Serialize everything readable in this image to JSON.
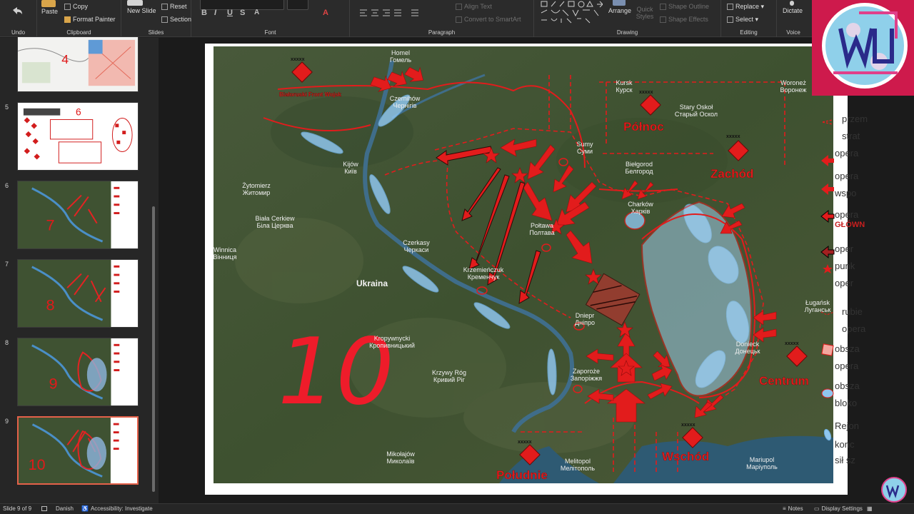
{
  "ribbon": {
    "undo": {
      "label": "Undo"
    },
    "clipboard": {
      "label": "Clipboard",
      "paste": "Paste",
      "copy": "Copy",
      "format_painter": "Format Painter"
    },
    "slides": {
      "label": "Slides",
      "new_slide": "New Slide",
      "reset": "Reset",
      "section": "Section"
    },
    "font": {
      "label": "Font",
      "bold": "B",
      "italic": "I",
      "underline": "U",
      "strike": "S",
      "aa": "A"
    },
    "paragraph": {
      "label": "Paragraph",
      "align_text": "Align Text",
      "convert_smartart": "Convert to SmartArt"
    },
    "drawing": {
      "label": "Drawing",
      "arrange": "Arrange",
      "quick_styles": "Quick Styles",
      "shape_outline": "Shape Outline",
      "shape_effects": "Shape Effects"
    },
    "editing": {
      "label": "Editing",
      "replace": "Replace",
      "select": "Select"
    },
    "voice": {
      "label": "Voice",
      "dictate": "Dictate"
    }
  },
  "thumbnails": [
    {
      "number": "",
      "label": "4"
    },
    {
      "number": "5",
      "label": "6"
    },
    {
      "number": "6",
      "label": "7"
    },
    {
      "number": "7",
      "label": "8"
    },
    {
      "number": "8",
      "label": "9"
    },
    {
      "number": "9",
      "label": "10"
    }
  ],
  "map": {
    "handwritten": "10",
    "country": "Ukraina",
    "fronts": {
      "north": "Północ",
      "west": "Zachód",
      "center": "Centrum",
      "east": "Wschód",
      "south": "Południe",
      "belarus": "Białoruski Front Wojsk"
    },
    "unit_mark": "xxxxx",
    "cities": [
      {
        "pl": "Homel",
        "local": "Гомель"
      },
      {
        "pl": "Kursk",
        "local": "Курск"
      },
      {
        "pl": "Woroneż",
        "local": "Воронеж"
      },
      {
        "pl": "Stary Oskoł",
        "local": "Старый Оскол"
      },
      {
        "pl": "Czernihów",
        "local": "Чернігів"
      },
      {
        "pl": "Sumy",
        "local": "Суми"
      },
      {
        "pl": "Biełgorod",
        "local": "Белгород"
      },
      {
        "pl": "Żytomierz",
        "local": "Житомир"
      },
      {
        "pl": "Kijów",
        "local": "Київ"
      },
      {
        "pl": "Charków",
        "local": "Харків"
      },
      {
        "pl": "Biała Cerkiew",
        "local": "Біла Церква"
      },
      {
        "pl": "Połtawa",
        "local": "Полтава"
      },
      {
        "pl": "Winnica",
        "local": "Вінниця"
      },
      {
        "pl": "Czerkasy",
        "local": "Черкаси"
      },
      {
        "pl": "Krzemieńczuk",
        "local": "Кременчук"
      },
      {
        "pl": "Ługańsk",
        "local": "Луганськ"
      },
      {
        "pl": "Dniepr",
        "local": "Дніпро"
      },
      {
        "pl": "Kropywnycki",
        "local": "Кропивницький"
      },
      {
        "pl": "Donieck",
        "local": "Донецьк"
      },
      {
        "pl": "Zaporoże",
        "local": "Запоріжжя"
      },
      {
        "pl": "Krzywy Róg",
        "local": "Кривий Ріг"
      },
      {
        "pl": "Mariupol",
        "local": "Маріуполь"
      },
      {
        "pl": "Mikołajów",
        "local": "Миколаїв"
      },
      {
        "pl": "Melitopol",
        "local": "Мелітополь"
      }
    ]
  },
  "legend": [
    "przem",
    "strat",
    "opera",
    "opera",
    "wspo",
    "opera",
    "GŁÓWN",
    "oper",
    "punk",
    "oper",
    "rubie",
    "opera",
    "obsza",
    "opera",
    "obsza",
    "bloko",
    "Rejon",
    "konc",
    "sił sz"
  ],
  "status": {
    "slide": "Slide 9 of 9",
    "language": "Danish",
    "accessibility": "Accessibility: Investigate",
    "notes": "Notes",
    "display_settings": "Display Settings"
  },
  "colors": {
    "accent": "#e4614a",
    "front_red": "#e21c1c",
    "blue_zone": "#8fc6ee",
    "map_green": "#3d4f2e"
  }
}
